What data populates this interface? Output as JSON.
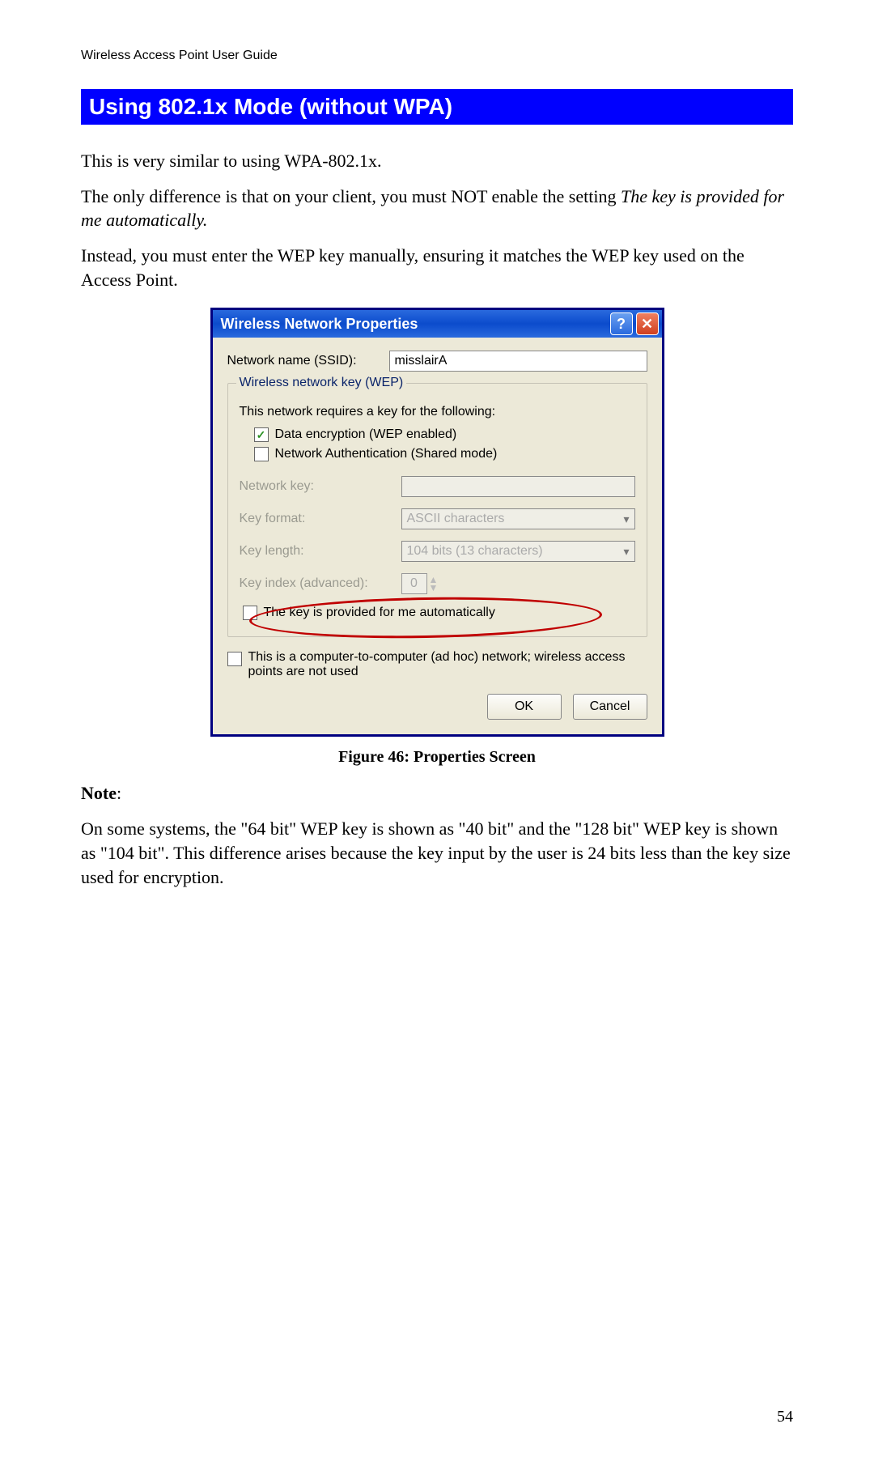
{
  "doc": {
    "header": "Wireless Access Point User Guide",
    "section_title": "Using 802.1x Mode (without WPA)",
    "para1": "This is very similar to using WPA-802.1x.",
    "para2_a": "The only difference is that on your client, you must NOT enable the setting ",
    "para2_b": "The key is provided for me automatically.",
    "para3": "Instead, you must enter the WEP key manually, ensuring it matches the WEP key used on the Access Point.",
    "caption": "Figure 46: Properties Screen",
    "note_label": "Note",
    "note_text": "On some systems, the \"64 bit\" WEP key is shown as \"40 bit\" and the \"128 bit\" WEP key is shown as \"104 bit\". This difference arises because the key input by the user is 24 bits less than the key size used for encryption.",
    "page_number": "54"
  },
  "dialog": {
    "title": "Wireless Network Properties",
    "help_label": "?",
    "close_label": "✕",
    "ssid_label": "Network name (SSID):",
    "ssid_value": "misslairA",
    "group_legend": "Wireless network key (WEP)",
    "group_intro": "This network requires a key for the following:",
    "chk_wep": "Data encryption (WEP enabled)",
    "chk_shared": "Network Authentication (Shared mode)",
    "netkey_label": "Network key:",
    "keyformat_label": "Key format:",
    "keyformat_value": "ASCII characters",
    "keylength_label": "Key length:",
    "keylength_value": "104 bits (13 characters)",
    "keyindex_label": "Key index (advanced):",
    "keyindex_value": "0",
    "chk_auto": "The key is provided for me automatically",
    "chk_adhoc": "This is a computer-to-computer (ad hoc) network; wireless access points are not used",
    "ok_label": "OK",
    "cancel_label": "Cancel"
  }
}
